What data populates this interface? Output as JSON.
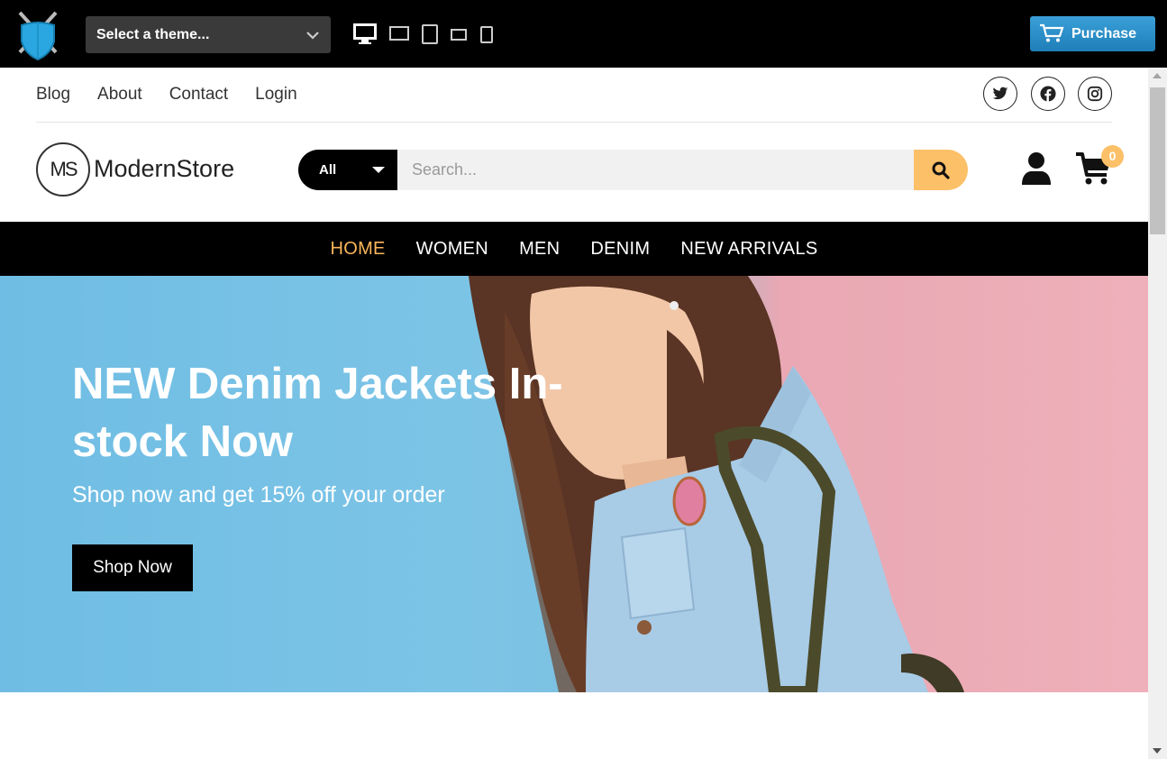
{
  "demo_bar": {
    "theme_select": "Select a theme...",
    "device_icons": [
      "desktop-icon",
      "laptop-icon",
      "tablet-icon",
      "tablet-landscape-icon",
      "phone-icon"
    ],
    "purchase_label": "Purchase"
  },
  "top_links": [
    "Blog",
    "About",
    "Contact",
    "Login"
  ],
  "social_icons": [
    "twitter-icon",
    "facebook-icon",
    "instagram-icon"
  ],
  "header": {
    "logo_mark": "MS",
    "logo_text": "ModernStore",
    "search_category": "All",
    "search_placeholder": "Search...",
    "cart_count": "0"
  },
  "nav": {
    "items": [
      "HOME",
      "WOMEN",
      "MEN",
      "DENIM",
      "NEW ARRIVALS"
    ],
    "active": "HOME"
  },
  "hero": {
    "title": "NEW Denim Jackets In-stock Now",
    "subtitle": "Shop now and get 15% off your order",
    "button": "Shop Now"
  },
  "colors": {
    "accent": "#fcc068",
    "nav_active": "#fcb65a",
    "purchase_blue": "#2a8fcb",
    "hero_blue": "#7cc4e6",
    "hero_pink": "#eeb0ba"
  }
}
